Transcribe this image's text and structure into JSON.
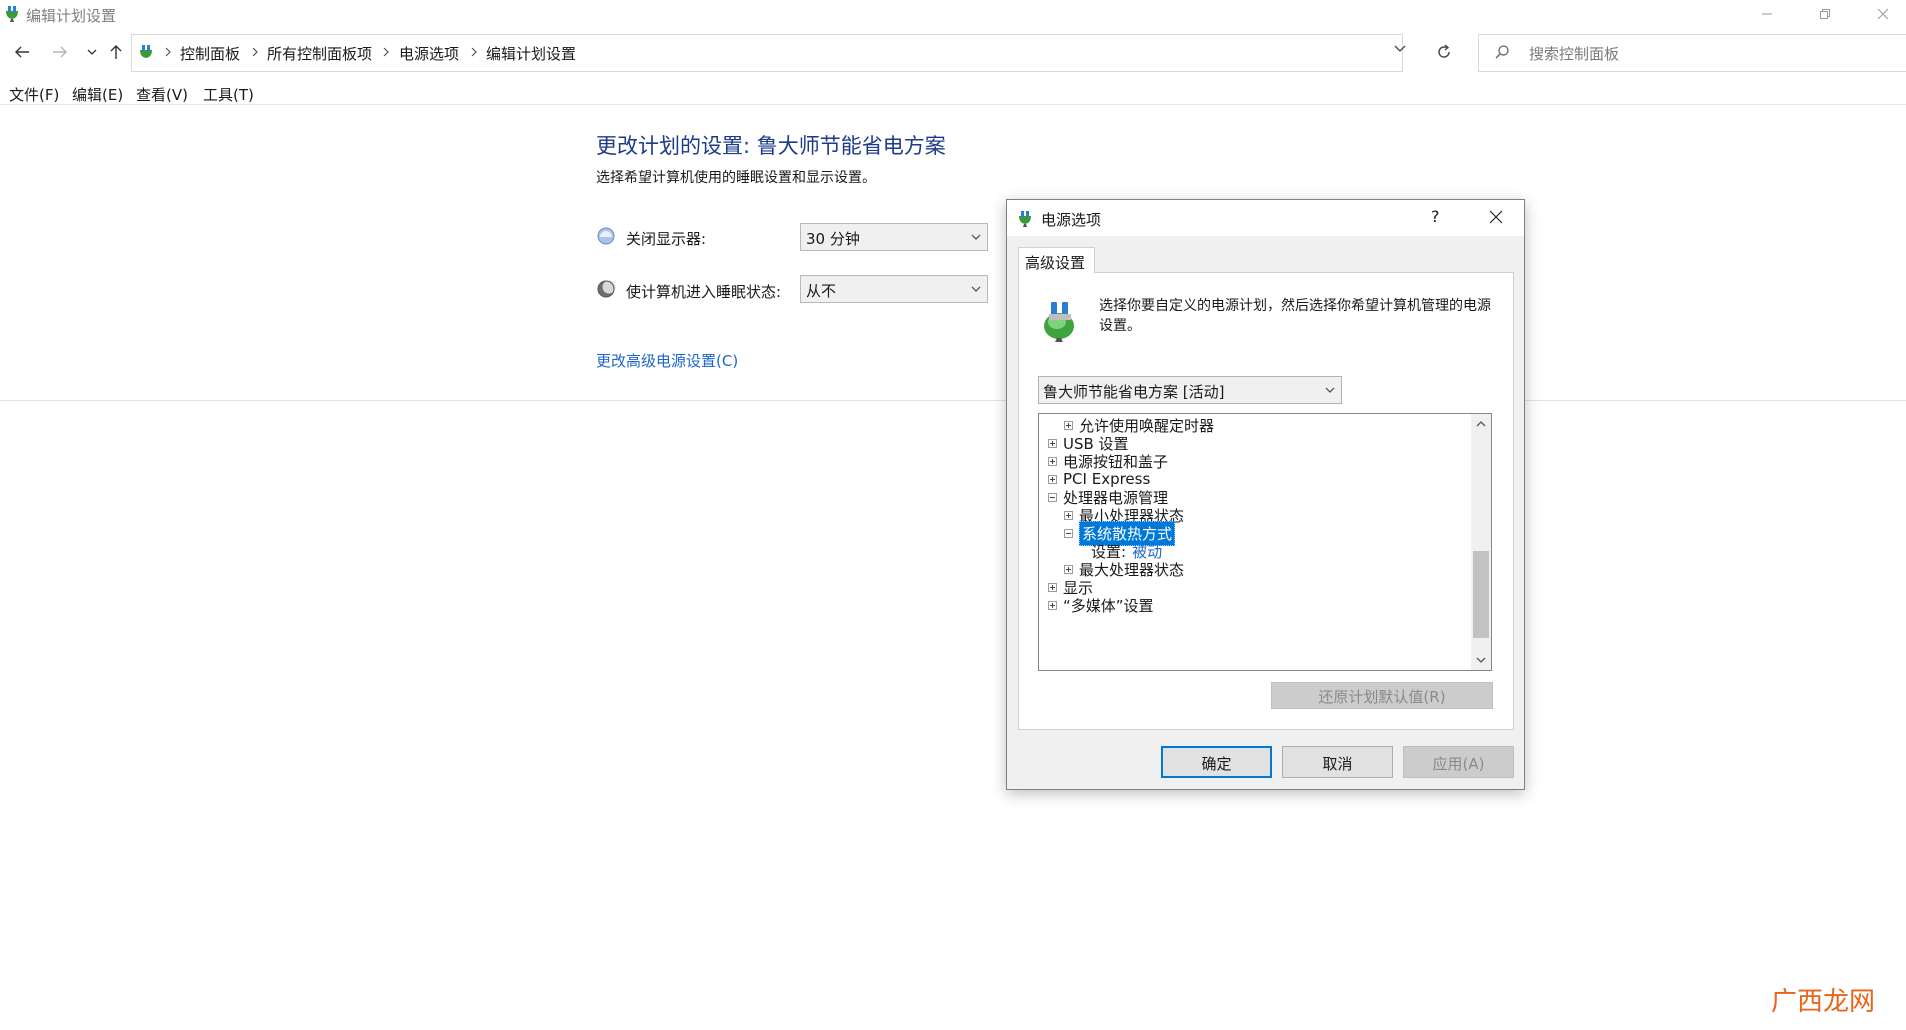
{
  "window": {
    "title": "编辑计划设置"
  },
  "breadcrumb": [
    "控制面板",
    "所有控制面板项",
    "电源选项",
    "编辑计划设置"
  ],
  "search": {
    "placeholder": "搜索控制面板"
  },
  "menu": [
    "文件(F)",
    "编辑(E)",
    "查看(V)",
    "工具(T)"
  ],
  "main": {
    "title": "更改计划的设置: 鲁大师节能省电方案",
    "subtitle": "选择希望计算机使用的睡眠设置和显示设置。",
    "display_off_label": "关闭显示器:",
    "display_off_value": "30 分钟",
    "sleep_label": "使计算机进入睡眠状态:",
    "sleep_value": "从不",
    "advanced_link": "更改高级电源设置(C)"
  },
  "dialog": {
    "title": "电源选项",
    "help": "?",
    "tab": "高级设置",
    "description": "选择你要自定义的电源计划，然后选择你希望计算机管理的电源设置。",
    "plan_select": "鲁大师节能省电方案 [活动]",
    "tree": [
      {
        "label": "允许使用唤醒定时器",
        "level": 1,
        "state": "collapsed"
      },
      {
        "label": "USB 设置",
        "level": 0,
        "state": "collapsed"
      },
      {
        "label": "电源按钮和盖子",
        "level": 0,
        "state": "collapsed"
      },
      {
        "label": "PCI Express",
        "level": 0,
        "state": "collapsed"
      },
      {
        "label": "处理器电源管理",
        "level": 0,
        "state": "expanded"
      },
      {
        "label": "最小处理器状态",
        "level": 1,
        "state": "collapsed"
      },
      {
        "label": "系统散热方式",
        "level": 1,
        "state": "expanded",
        "selected": true
      },
      {
        "label": "设置:",
        "value": "被动",
        "level": 2,
        "state": "leaf"
      },
      {
        "label": "最大处理器状态",
        "level": 1,
        "state": "collapsed"
      },
      {
        "label": "显示",
        "level": 0,
        "state": "collapsed"
      },
      {
        "label": "“多媒体”设置",
        "level": 0,
        "state": "collapsed"
      }
    ],
    "restore_button": "还原计划默认值(R)",
    "ok_button": "确定",
    "cancel_button": "取消",
    "apply_button": "应用(A)"
  },
  "watermark": "广西龙网",
  "colors": {
    "accent": "#0078d7",
    "link": "#1e66c8",
    "title_blue": "#1e3a8a",
    "watermark": "#e8641b"
  }
}
